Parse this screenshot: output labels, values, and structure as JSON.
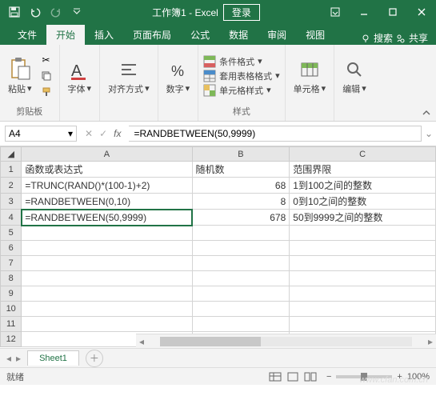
{
  "titlebar": {
    "title_doc": "工作簿1",
    "title_app": "Excel",
    "login": "登录"
  },
  "tabs": {
    "items": [
      "文件",
      "开始",
      "插入",
      "页面布局",
      "公式",
      "数据",
      "审阅",
      "视图"
    ],
    "active_index": 1,
    "search": "搜索",
    "share": "共享"
  },
  "ribbon": {
    "clipboard": {
      "label": "剪贴板",
      "paste": "粘贴"
    },
    "font": {
      "label": "字体"
    },
    "alignment": {
      "label": "对齐方式"
    },
    "number": {
      "label": "数字"
    },
    "styles": {
      "label": "样式",
      "conditional": "条件格式",
      "as_table": "套用表格格式",
      "cell_styles": "单元格样式"
    },
    "cells": {
      "label": "单元格"
    },
    "editing": {
      "label": "编辑"
    }
  },
  "formula_bar": {
    "name_box": "A4",
    "formula": "=RANDBETWEEN(50,9999)"
  },
  "grid": {
    "columns": [
      "A",
      "B",
      "C"
    ],
    "headers": {
      "A": "函数或表达式",
      "B": "随机数",
      "C": "范围界限"
    },
    "rows": [
      {
        "n": 1,
        "A": "函数或表达式",
        "B": "随机数",
        "C": "范围界限",
        "B_is_num": false
      },
      {
        "n": 2,
        "A": "=TRUNC(RAND()*(100-1)+2)",
        "B": "68",
        "C": "1到100之间的整数",
        "B_is_num": true
      },
      {
        "n": 3,
        "A": "=RANDBETWEEN(0,10)",
        "B": "8",
        "C": "0到10之间的整数",
        "B_is_num": true
      },
      {
        "n": 4,
        "A": "=RANDBETWEEN(50,9999)",
        "B": "678",
        "C": "50到9999之间的整数",
        "B_is_num": true
      },
      {
        "n": 5,
        "A": "",
        "B": "",
        "C": ""
      },
      {
        "n": 6,
        "A": "",
        "B": "",
        "C": ""
      },
      {
        "n": 7,
        "A": "",
        "B": "",
        "C": ""
      },
      {
        "n": 8,
        "A": "",
        "B": "",
        "C": ""
      },
      {
        "n": 9,
        "A": "",
        "B": "",
        "C": ""
      },
      {
        "n": 10,
        "A": "",
        "B": "",
        "C": ""
      },
      {
        "n": 11,
        "A": "",
        "B": "",
        "C": ""
      },
      {
        "n": 12,
        "A": "",
        "B": "",
        "C": ""
      }
    ],
    "selected": {
      "row": 4,
      "col": "A"
    }
  },
  "sheet_tabs": {
    "active": "Sheet1"
  },
  "statusbar": {
    "ready": "就绪",
    "zoom": "100%"
  },
  "watermark": "www.cfan.com.cn",
  "colors": {
    "brand": "#217346"
  }
}
